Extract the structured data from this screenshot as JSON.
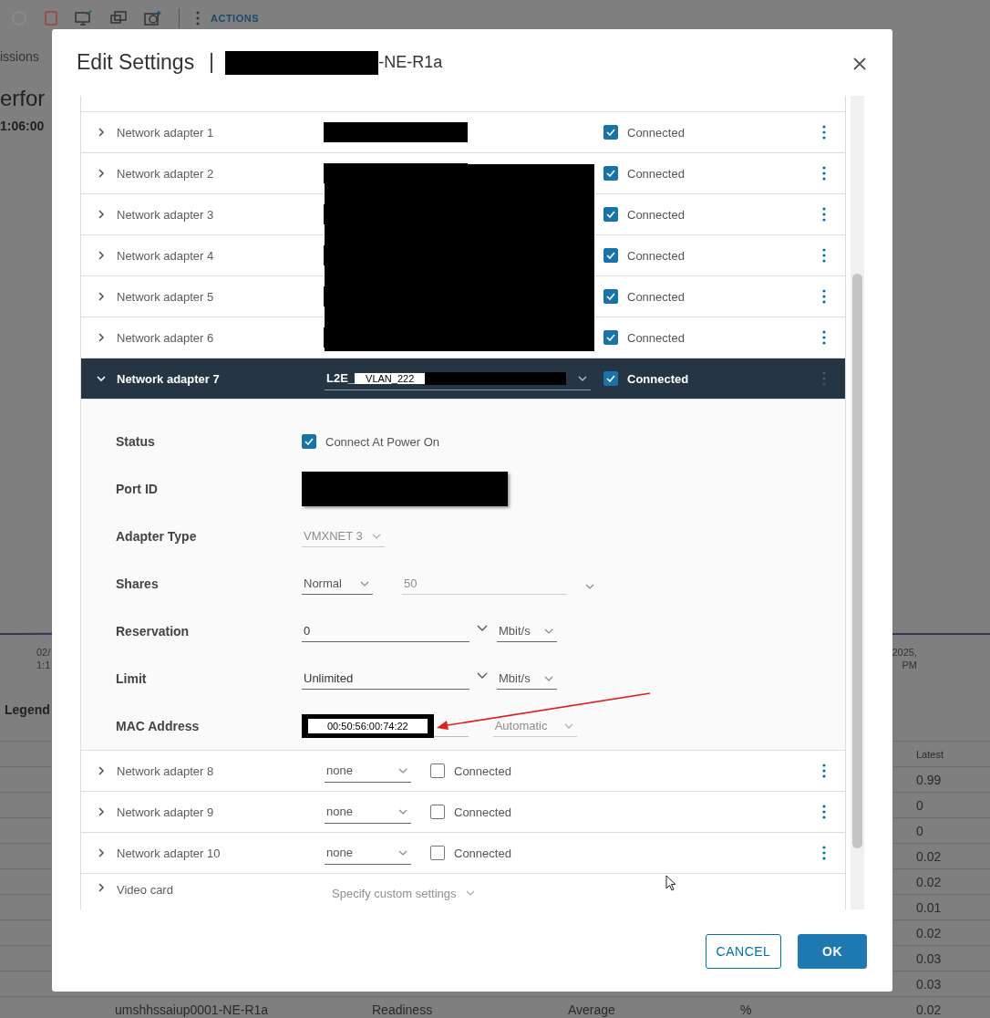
{
  "background_page": {
    "toolbar": {
      "actions_label": "ACTIONS"
    },
    "tab": "issions",
    "heading": "erfor",
    "time": "1:06:00",
    "chart_left_labels": [
      "02/",
      "1:1"
    ],
    "chart_right_labels": [
      "2025,",
      "PM"
    ],
    "legend": "Legend",
    "table": {
      "columns": [
        "Latest"
      ],
      "rows": [
        {
          "latest": "0.99"
        },
        {
          "latest": "0"
        },
        {
          "latest": "0"
        },
        {
          "latest": "0.02"
        },
        {
          "latest": "0.02"
        },
        {
          "latest": "0.01"
        },
        {
          "latest": "0.02"
        },
        {
          "latest": "0.03"
        },
        {
          "latest": "0.03"
        },
        {
          "column_1": "umshhssaiup0001-NE-R1a",
          "column_2": "Readiness",
          "column_3": "Average",
          "column_4": "%",
          "latest": "0.02"
        }
      ]
    }
  },
  "dialog": {
    "title": "Edit Settings",
    "vm_name": "-NE-R1a",
    "adapters": [
      {
        "name": "Network adapter 1",
        "kind": "redacted",
        "expanded": false,
        "connected": true,
        "connected_label": "Connected"
      },
      {
        "name": "Network adapter 2",
        "kind": "redacted",
        "expanded": false,
        "connected": true,
        "connected_label": "Connected"
      },
      {
        "name": "Network adapter 3",
        "kind": "redacted",
        "expanded": false,
        "connected": true,
        "connected_label": "Connected"
      },
      {
        "name": "Network adapter 4",
        "kind": "redacted",
        "expanded": false,
        "connected": true,
        "connected_label": "Connected"
      },
      {
        "name": "Network adapter 5",
        "kind": "redacted",
        "expanded": false,
        "connected": true,
        "connected_label": "Connected"
      },
      {
        "name": "Network adapter 6",
        "kind": "redacted",
        "expanded": false,
        "connected": true,
        "connected_label": "Connected"
      },
      {
        "name": "Network adapter 7",
        "kind": "select",
        "network": "L2E_",
        "network_tag": "VLAN_222",
        "expanded": true,
        "connected": true,
        "connected_label": "Connected",
        "details": [
          {
            "kind": "checkbox",
            "label": "Status",
            "checked": true,
            "text": "Connect At Power On"
          },
          {
            "kind": "redacted",
            "label": "Port ID"
          },
          {
            "kind": "select",
            "label": "Adapter Type",
            "value": "VMXNET 3",
            "disabled": true
          },
          {
            "kind": "shares",
            "label": "Shares",
            "value": "Normal",
            "number": "50"
          },
          {
            "kind": "amount",
            "label": "Reservation",
            "value": "0",
            "unit": "Mbit/s"
          },
          {
            "kind": "amount",
            "label": "Limit",
            "value": "Unlimited",
            "unit": "Mbit/s"
          },
          {
            "kind": "mac",
            "label": "MAC Address",
            "value": "00:50:56:00:74:22",
            "mode": "Automatic"
          }
        ]
      },
      {
        "name": "Network adapter 8",
        "kind": "select",
        "network": "none",
        "expanded": false,
        "connected": false,
        "connected_label": "Connected"
      },
      {
        "name": "Network adapter 9",
        "kind": "select",
        "network": "none",
        "expanded": false,
        "connected": false,
        "connected_label": "Connected"
      },
      {
        "name": "Network adapter 10",
        "kind": "select",
        "network": "none",
        "expanded": false,
        "connected": false,
        "connected_label": "Connected"
      }
    ],
    "video_card": {
      "name": "Video card",
      "value": "Specify custom settings"
    },
    "buttons": {
      "cancel": "CANCEL",
      "ok": "OK"
    }
  }
}
